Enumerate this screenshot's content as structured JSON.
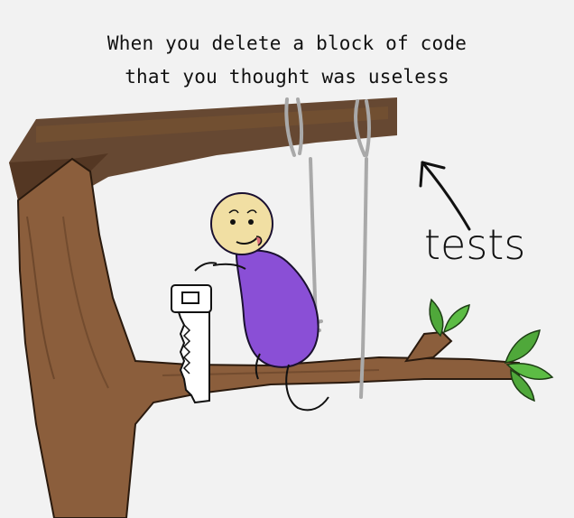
{
  "caption": {
    "line1": "When you delete a block of code",
    "line2": "that you thought was useless"
  },
  "annotation": {
    "text": "tests"
  },
  "colors": {
    "background": "#f2f2f2",
    "branch": "#8b5e3c",
    "top_branch": "#5a3a22",
    "body": "#8a4fd6",
    "head": "#f1dfa3",
    "rope": "#a9a9a9",
    "leaf": "#4fa83a"
  },
  "icons": [
    "saw-icon",
    "arrow-icon",
    "leaf-icon"
  ]
}
